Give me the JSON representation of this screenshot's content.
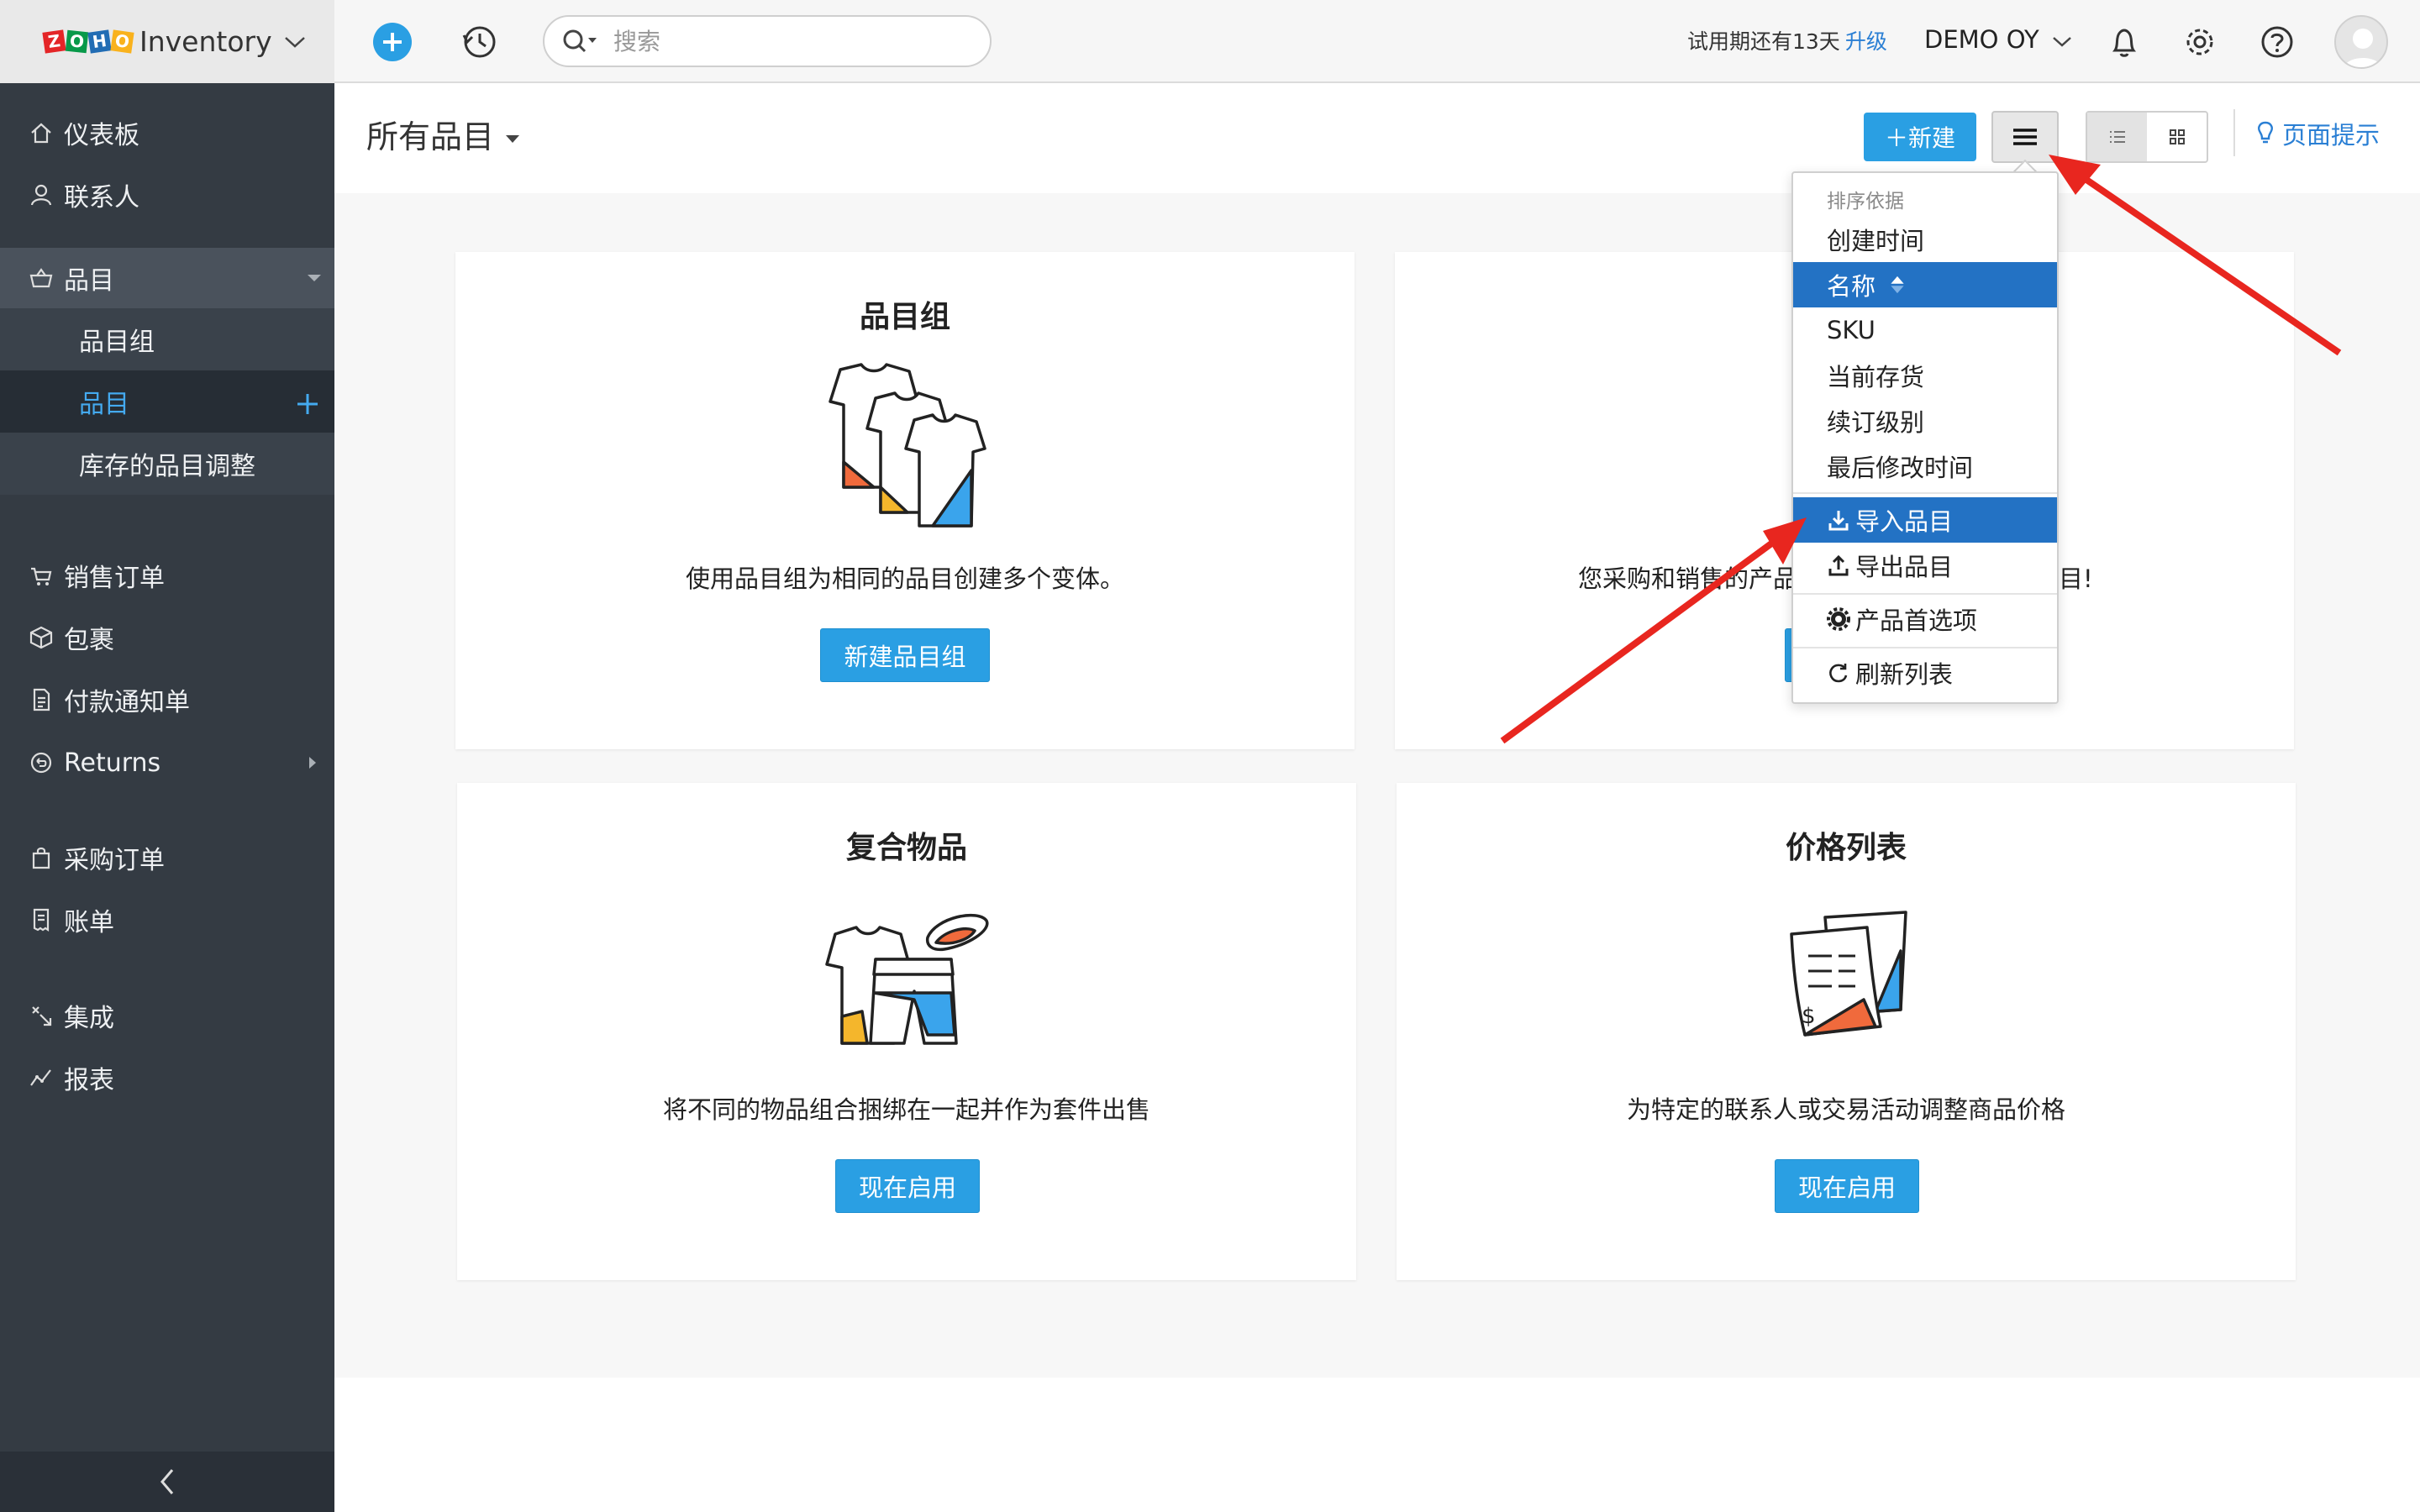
{
  "app": {
    "logo_letters": [
      "Z",
      "O",
      "H",
      "O"
    ],
    "logo_colors": [
      "#e42527",
      "#089949",
      "#226db4",
      "#f9b21d"
    ],
    "name": "Inventory"
  },
  "topbar": {
    "search_placeholder": "搜索",
    "trial_text": "试用期还有13天",
    "upgrade_label": "升级",
    "org_name": "DEMO OY"
  },
  "sidebar": {
    "items": [
      {
        "label": "仪表板",
        "icon": "home-icon"
      },
      {
        "label": "联系人",
        "icon": "user-icon"
      },
      {
        "label": "品目",
        "icon": "basket-icon"
      },
      {
        "label": "销售订单",
        "icon": "cart-icon"
      },
      {
        "label": "包裹",
        "icon": "package-icon"
      },
      {
        "label": "付款通知单",
        "icon": "invoice-icon"
      },
      {
        "label": "Returns",
        "icon": "returns-icon"
      },
      {
        "label": "采购订单",
        "icon": "bag-icon"
      },
      {
        "label": "账单",
        "icon": "bill-icon"
      },
      {
        "label": "集成",
        "icon": "integration-icon"
      },
      {
        "label": "报表",
        "icon": "reports-icon"
      }
    ],
    "sub_items": [
      {
        "label": "品目组"
      },
      {
        "label": "品目"
      },
      {
        "label": "库存的品目调整"
      }
    ]
  },
  "header": {
    "title": "所有品目",
    "new_button": "＋新建",
    "page_tips": "页面提示"
  },
  "cards": [
    {
      "title": "品目组",
      "description": "使用品目组为相同的品目创建多个变体。",
      "button": "新建品目组"
    },
    {
      "title": "",
      "description_left": "您采购和销售的产品",
      "description_right": "目!",
      "button": ""
    },
    {
      "title": "复合物品",
      "description": "将不同的物品组合捆绑在一起并作为套件出售",
      "button": "现在启用"
    },
    {
      "title": "价格列表",
      "description": "为特定的联系人或交易活动调整商品价格",
      "button": "现在启用"
    }
  ],
  "dropdown": {
    "sort_header": "排序依据",
    "sort_options": [
      "创建时间",
      "名称",
      "SKU",
      "当前存货",
      "续订级别",
      "最后修改时间"
    ],
    "selected_sort": "名称",
    "actions": [
      {
        "label": "导入品目",
        "icon": "import-icon"
      },
      {
        "label": "导出品目",
        "icon": "export-icon"
      },
      {
        "label": "产品首选项",
        "icon": "gear-icon"
      },
      {
        "label": "刷新列表",
        "icon": "refresh-icon"
      }
    ]
  },
  "colors": {
    "accent": "#2a9fe3",
    "sidebar_bg": "#343b43",
    "selected": "#2372c4",
    "annotation_arrow": "#e8261f"
  }
}
